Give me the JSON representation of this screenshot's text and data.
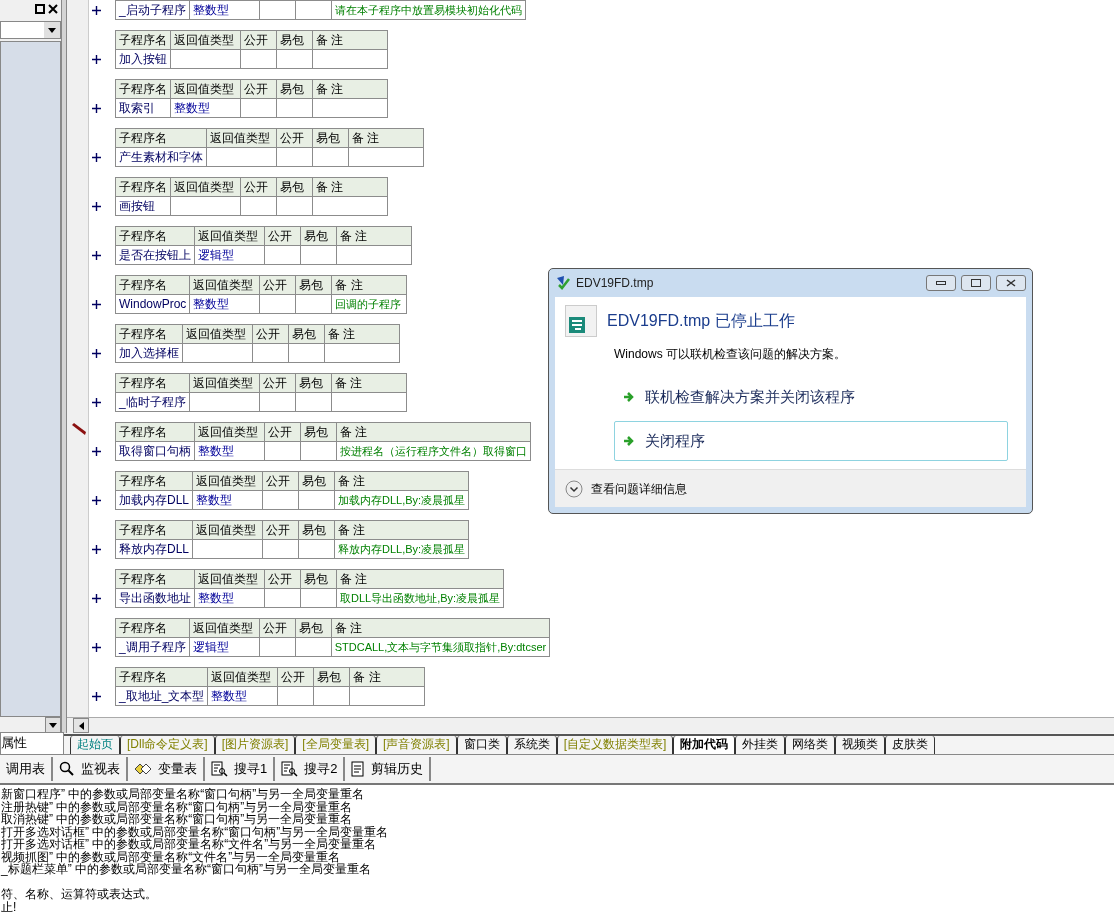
{
  "left_panel": {
    "tab": "属性"
  },
  "procedures": [
    {
      "name": "_启动子程序",
      "return_type": "整数型",
      "remark": "请在本子程序中放置易模块初始化代码",
      "editing": false
    },
    {
      "columns": [
        "子程序名",
        "返回值类型",
        "公开",
        "易包",
        "备 注"
      ],
      "name": "加入按钮",
      "editing": false
    },
    {
      "columns": [
        "子程序名",
        "返回值类型",
        "公开",
        "易包",
        "备 注"
      ],
      "name": "取索引",
      "return_type": "整数型",
      "editing": false
    },
    {
      "columns": [
        "子程序名",
        "返回值类型",
        "公开",
        "易包",
        "备 注"
      ],
      "name": "产生素材和字体",
      "editing": false
    },
    {
      "columns": [
        "子程序名",
        "返回值类型",
        "公开",
        "易包",
        "备 注"
      ],
      "name": "画按钮",
      "editing": false
    },
    {
      "columns": [
        "子程序名",
        "返回值类型",
        "公开",
        "易包",
        "备 注"
      ],
      "name": "是否在按钮上",
      "return_type": "逻辑型",
      "editing": false
    },
    {
      "columns": [
        "子程序名",
        "返回值类型",
        "公开",
        "易包",
        "备 注"
      ],
      "name": "WindowProc",
      "return_type": "整数型",
      "remark": "回调的子程序",
      "editing": false
    },
    {
      "columns": [
        "子程序名",
        "返回值类型",
        "公开",
        "易包",
        "备 注"
      ],
      "name": "加入选择框",
      "editing": false
    },
    {
      "columns": [
        "子程序名",
        "返回值类型",
        "公开",
        "易包",
        "备 注"
      ],
      "name": "_临时子程序",
      "editing": false
    },
    {
      "columns": [
        "子程序名",
        "返回值类型",
        "公开",
        "易包",
        "备 注"
      ],
      "name": "取得窗口句柄",
      "return_type": "整数型",
      "remark": "按进程名（运行程序文件名）取得窗口",
      "editing": true
    },
    {
      "columns": [
        "子程序名",
        "返回值类型",
        "公开",
        "易包",
        "备 注"
      ],
      "name": "加载内存DLL",
      "return_type": "整数型",
      "remark": "加载内存DLL,By:凌晨孤星",
      "editing": false
    },
    {
      "columns": [
        "子程序名",
        "返回值类型",
        "公开",
        "易包",
        "备 注"
      ],
      "name": "释放内存DLL",
      "remark": "释放内存DLL,By:凌晨孤星",
      "editing": false
    },
    {
      "columns": [
        "子程序名",
        "返回值类型",
        "公开",
        "易包",
        "备 注"
      ],
      "name": "导出函数地址",
      "return_type": "整数型",
      "remark": "取DLL导出函数地址,By:凌晨孤星",
      "editing": false
    },
    {
      "columns": [
        "子程序名",
        "返回值类型",
        "公开",
        "易包",
        "备 注"
      ],
      "name": "_调用子程序",
      "return_type": "逻辑型",
      "remark": "STDCALL,文本与字节集须取指针,By:dtcser",
      "editing": false
    },
    {
      "columns": [
        "子程序名",
        "返回值类型",
        "公开",
        "易包",
        "备 注"
      ],
      "name": "_取地址_文本型",
      "return_type": "整数型",
      "editing": false
    }
  ],
  "tabs": [
    {
      "label": "起始页",
      "kind": "start",
      "selected": false
    },
    {
      "label": "[Dll命令定义表]",
      "kind": "table",
      "selected": false
    },
    {
      "label": "[图片资源表]",
      "kind": "table",
      "selected": false
    },
    {
      "label": "[全局变量表]",
      "kind": "table",
      "selected": false
    },
    {
      "label": "[声音资源表]",
      "kind": "table",
      "selected": false
    },
    {
      "label": "窗口类",
      "kind": "module",
      "selected": false
    },
    {
      "label": "系统类",
      "kind": "module",
      "selected": false
    },
    {
      "label": "[自定义数据类型表]",
      "kind": "table",
      "selected": false
    },
    {
      "label": "附加代码",
      "kind": "module",
      "selected": true
    },
    {
      "label": "外挂类",
      "kind": "module",
      "selected": false
    },
    {
      "label": "网络类",
      "kind": "module",
      "selected": false
    },
    {
      "label": "视频类",
      "kind": "module",
      "selected": false
    },
    {
      "label": "皮肤类",
      "kind": "module",
      "selected": false
    }
  ],
  "tools": [
    {
      "label": "调用表",
      "kind": "plain"
    },
    {
      "label": "监视表",
      "kind": "watch"
    },
    {
      "label": "变量表",
      "kind": "vars"
    },
    {
      "label": "搜寻1",
      "kind": "find"
    },
    {
      "label": "搜寻2",
      "kind": "find"
    },
    {
      "label": "剪辑历史",
      "kind": "clip"
    }
  ],
  "output": [
    {
      "lines": [
        "新窗口程序” 中的参数或局部变量名称“窗口句柄”与另一全局变量重名",
        "注册热键” 中的参数或局部变量名称“窗口句柄”与另一全局变量重名",
        "取消热键” 中的参数或局部变量名称“窗口句柄”与另一全局变量重名",
        "打开多选对话框” 中的参数或局部变量名称“窗口句柄”与另一全局变量重名",
        "打开多选对话框” 中的参数或局部变量名称“文件名”与另一全局变量重名",
        "视频抓图” 中的参数或局部变量名称“文件名”与另一全局变量重名",
        "_标题栏菜单” 中的参数或局部变量名称“窗口句柄”与另一全局变量重名"
      ]
    },
    {
      "lines": [
        "符、名称、运算符或表达式。",
        "止!"
      ]
    }
  ],
  "dialog": {
    "title": "EDV19FD.tmp",
    "heading": "EDV19FD.tmp 已停止工作",
    "message": "Windows 可以联机检查该问题的解决方案。",
    "options": [
      {
        "label": "联机检查解决方案并关闭该程序",
        "selected": false
      },
      {
        "label": "关闭程序",
        "selected": true
      }
    ],
    "details": "查看问题详细信息"
  }
}
